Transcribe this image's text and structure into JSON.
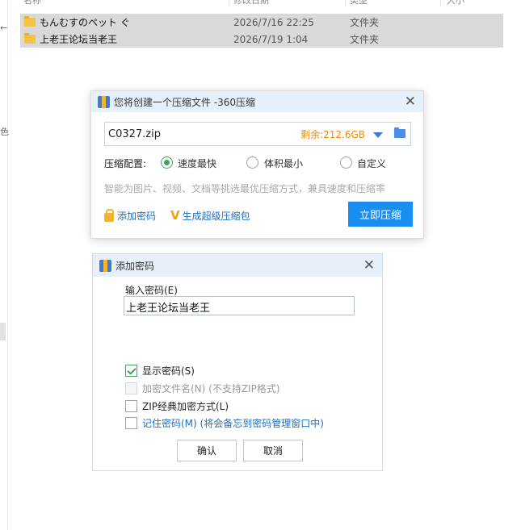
{
  "explorer": {
    "left_marks": [
      "←",
      "色"
    ],
    "columns": [
      "名称",
      "修改日期",
      "类型",
      "大小"
    ],
    "files": [
      {
        "name": "もんむすのペット ぐ",
        "date": "2026/7/16 22:25",
        "type": "文件夹"
      },
      {
        "name": "上老王论坛当老王",
        "date": "2026/7/19 1:04",
        "type": "文件夹"
      }
    ]
  },
  "compress_dialog": {
    "title": "您将创建一个压缩文件 -360压缩",
    "filename": "C0327.zip",
    "free_space": "剩余:212.6GB",
    "config_label": "压缩配置:",
    "options": [
      {
        "label": "速度最快",
        "selected": true
      },
      {
        "label": "体积最小",
        "selected": false
      },
      {
        "label": "自定义",
        "selected": false
      }
    ],
    "hint": "智能为图片、视频、文档等挑选最优压缩方式，兼具速度和压缩率",
    "add_password": "添加密码",
    "super_package": "生成超级压缩包",
    "compress_now": "立即压缩"
  },
  "password_dialog": {
    "title": "添加密码",
    "input_label": "输入密码(E)",
    "password_value": "上老王论坛当老王",
    "checks": [
      {
        "label": "显示密码(S)",
        "checked": true,
        "disabled": false
      },
      {
        "label": "加密文件名(N) (不支持ZIP格式)",
        "checked": false,
        "disabled": true
      },
      {
        "label": "ZIP经典加密方式(L)",
        "checked": false,
        "disabled": false
      },
      {
        "label": "记住密码(M) (将会备忘到密码管理窗口中)",
        "checked": false,
        "disabled": false
      }
    ],
    "ok": "确认",
    "cancel": "取消"
  },
  "colors": {
    "accent_blue": "#1a8ef0",
    "title_bar": "#e6f0fb",
    "check_green": "#3da55a",
    "space_orange": "#f08c00"
  }
}
